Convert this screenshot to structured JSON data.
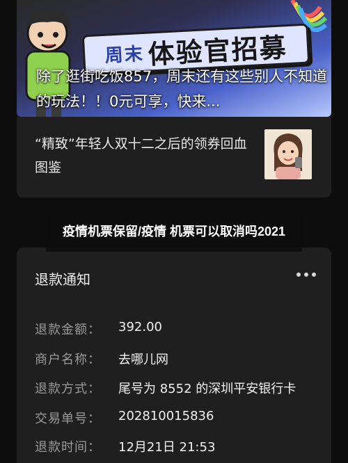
{
  "banner": {
    "art_title_small": "周末",
    "art_title": "体验官招募",
    "caption": "除了逛街吃饭857，周末还有这些别人不知道的玩法！！0元可享，快来..."
  },
  "article": {
    "title": "“精致”年轻人双十二之后的领券回血图鉴"
  },
  "overlay": {
    "title": "疫情机票保留/疫情 机票可以取消吗2021"
  },
  "refund": {
    "header": "退款通知",
    "more_icon": "more-dots-icon",
    "rows": [
      {
        "label": "退款金额：",
        "value": "392.00"
      },
      {
        "label": "商户名称：",
        "value": "去哪儿网"
      },
      {
        "label": "退款方式：",
        "value": "尾号为 8552 的深圳平安银行卡"
      },
      {
        "label": "交易单号：",
        "value": "202810015836"
      },
      {
        "label": "退款时间：",
        "value": "12月21日 21:53"
      }
    ]
  },
  "colors": {
    "background": "#0d0d0d",
    "card": "#1f1f1f",
    "label": "#9a9a9a",
    "text": "#f2f2f2"
  }
}
